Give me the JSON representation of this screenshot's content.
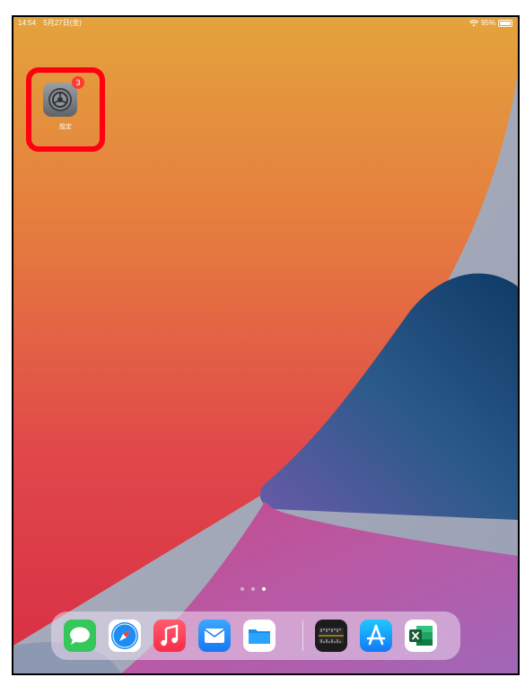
{
  "status_bar": {
    "time": "14:54",
    "date": "5月27日(金)",
    "battery": "95%"
  },
  "home": {
    "apps": [
      {
        "label": "設定",
        "badge": "3",
        "icon": "settings-gear-icon"
      }
    ]
  },
  "dock": {
    "apps": [
      {
        "icon": "messages-icon"
      },
      {
        "icon": "safari-icon"
      },
      {
        "icon": "music-icon"
      },
      {
        "icon": "mail-icon"
      },
      {
        "icon": "files-icon"
      },
      {
        "icon": "measure-icon"
      },
      {
        "icon": "app-store-icon"
      },
      {
        "icon": "excel-icon"
      }
    ]
  },
  "colors": {
    "highlight": "#ff0010",
    "badge": "#ff3b30"
  }
}
